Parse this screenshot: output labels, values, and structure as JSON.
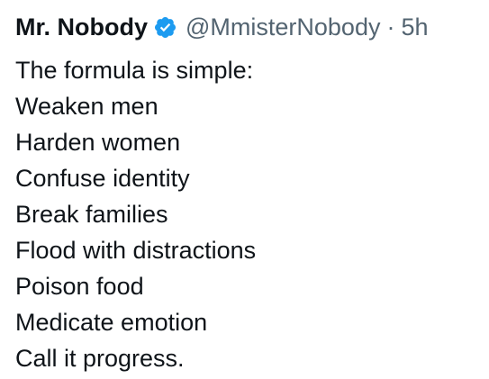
{
  "tweet": {
    "author": {
      "display_name": "Mr. Nobody",
      "handle": "@MmisterNobody",
      "verified_icon": "verified-badge-icon",
      "verified_color": "#1d9bf0"
    },
    "separator": "·",
    "timestamp": "5h",
    "lines": [
      "The formula is simple:",
      "Weaken men",
      "Harden women",
      "Confuse identity",
      "Break families",
      "Flood with distractions",
      "Poison food",
      "Medicate emotion",
      "Call it progress."
    ]
  }
}
